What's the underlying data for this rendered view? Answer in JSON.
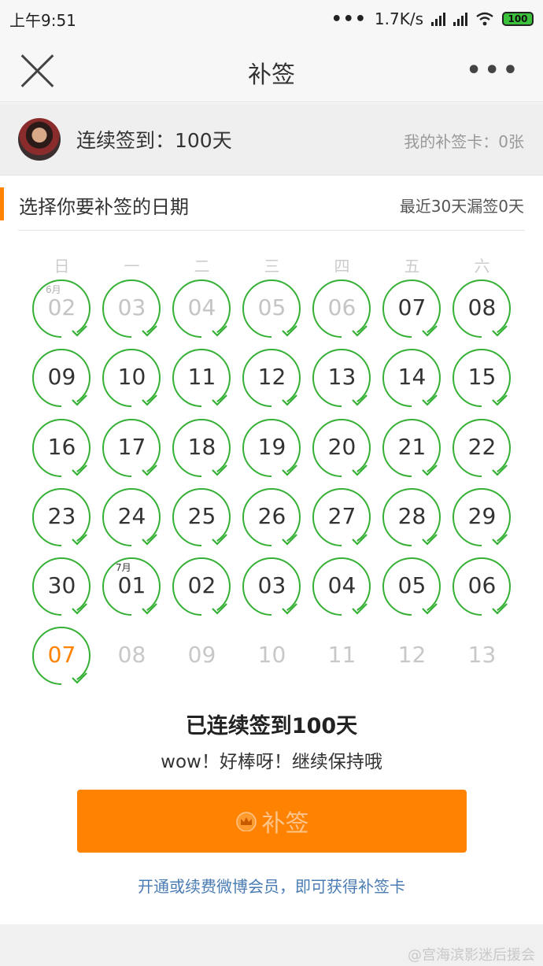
{
  "status_bar": {
    "time": "上午9:51",
    "net_speed": "1.7K/s",
    "battery": "100"
  },
  "header": {
    "title": "补签"
  },
  "user": {
    "streak_label": "连续签到：100天",
    "card_count": "我的补签卡：0张"
  },
  "section": {
    "title": "选择你要补签的日期",
    "missed_info": "最近30天漏签0天"
  },
  "calendar": {
    "weekdays": [
      "日",
      "一",
      "二",
      "三",
      "四",
      "五",
      "六"
    ],
    "colors": {
      "ring": "#35b035",
      "accent": "#ff8200"
    },
    "days": [
      {
        "label": "02",
        "month": "6月",
        "state": "past",
        "checked": true
      },
      {
        "label": "03",
        "state": "past",
        "checked": true
      },
      {
        "label": "04",
        "state": "past",
        "checked": true
      },
      {
        "label": "05",
        "state": "past",
        "checked": true
      },
      {
        "label": "06",
        "state": "past",
        "checked": true
      },
      {
        "label": "07",
        "state": "norm",
        "checked": true
      },
      {
        "label": "08",
        "state": "norm",
        "checked": true
      },
      {
        "label": "09",
        "state": "norm",
        "checked": true
      },
      {
        "label": "10",
        "state": "norm",
        "checked": true
      },
      {
        "label": "11",
        "state": "norm",
        "checked": true
      },
      {
        "label": "12",
        "state": "norm",
        "checked": true
      },
      {
        "label": "13",
        "state": "norm",
        "checked": true
      },
      {
        "label": "14",
        "state": "norm",
        "checked": true
      },
      {
        "label": "15",
        "state": "norm",
        "checked": true
      },
      {
        "label": "16",
        "state": "norm",
        "checked": true
      },
      {
        "label": "17",
        "state": "norm",
        "checked": true
      },
      {
        "label": "18",
        "state": "norm",
        "checked": true
      },
      {
        "label": "19",
        "state": "norm",
        "checked": true
      },
      {
        "label": "20",
        "state": "norm",
        "checked": true
      },
      {
        "label": "21",
        "state": "norm",
        "checked": true
      },
      {
        "label": "22",
        "state": "norm",
        "checked": true
      },
      {
        "label": "23",
        "state": "norm",
        "checked": true
      },
      {
        "label": "24",
        "state": "norm",
        "checked": true
      },
      {
        "label": "25",
        "state": "norm",
        "checked": true
      },
      {
        "label": "26",
        "state": "norm",
        "checked": true
      },
      {
        "label": "27",
        "state": "norm",
        "checked": true
      },
      {
        "label": "28",
        "state": "norm",
        "checked": true
      },
      {
        "label": "29",
        "state": "norm",
        "checked": true
      },
      {
        "label": "30",
        "state": "norm",
        "checked": true
      },
      {
        "label": "01",
        "month": "7月",
        "state": "norm",
        "checked": true
      },
      {
        "label": "02",
        "state": "norm",
        "checked": true
      },
      {
        "label": "03",
        "state": "norm",
        "checked": true
      },
      {
        "label": "04",
        "state": "norm",
        "checked": true
      },
      {
        "label": "05",
        "state": "norm",
        "checked": true
      },
      {
        "label": "06",
        "state": "norm",
        "checked": true
      },
      {
        "label": "07",
        "state": "today",
        "checked": true
      },
      {
        "label": "08",
        "state": "future",
        "checked": false
      },
      {
        "label": "09",
        "state": "future",
        "checked": false
      },
      {
        "label": "10",
        "state": "future",
        "checked": false
      },
      {
        "label": "11",
        "state": "future",
        "checked": false
      },
      {
        "label": "12",
        "state": "future",
        "checked": false
      },
      {
        "label": "13",
        "state": "future",
        "checked": false
      }
    ]
  },
  "result": {
    "title": "已连续签到100天",
    "subtitle": "wow！好棒呀！继续保持哦"
  },
  "button": {
    "label": "补签",
    "icon": "crown-icon"
  },
  "vip_link": "开通或续费微博会员，即可获得补签卡",
  "watermark": "@宫海滨影迷后援会"
}
